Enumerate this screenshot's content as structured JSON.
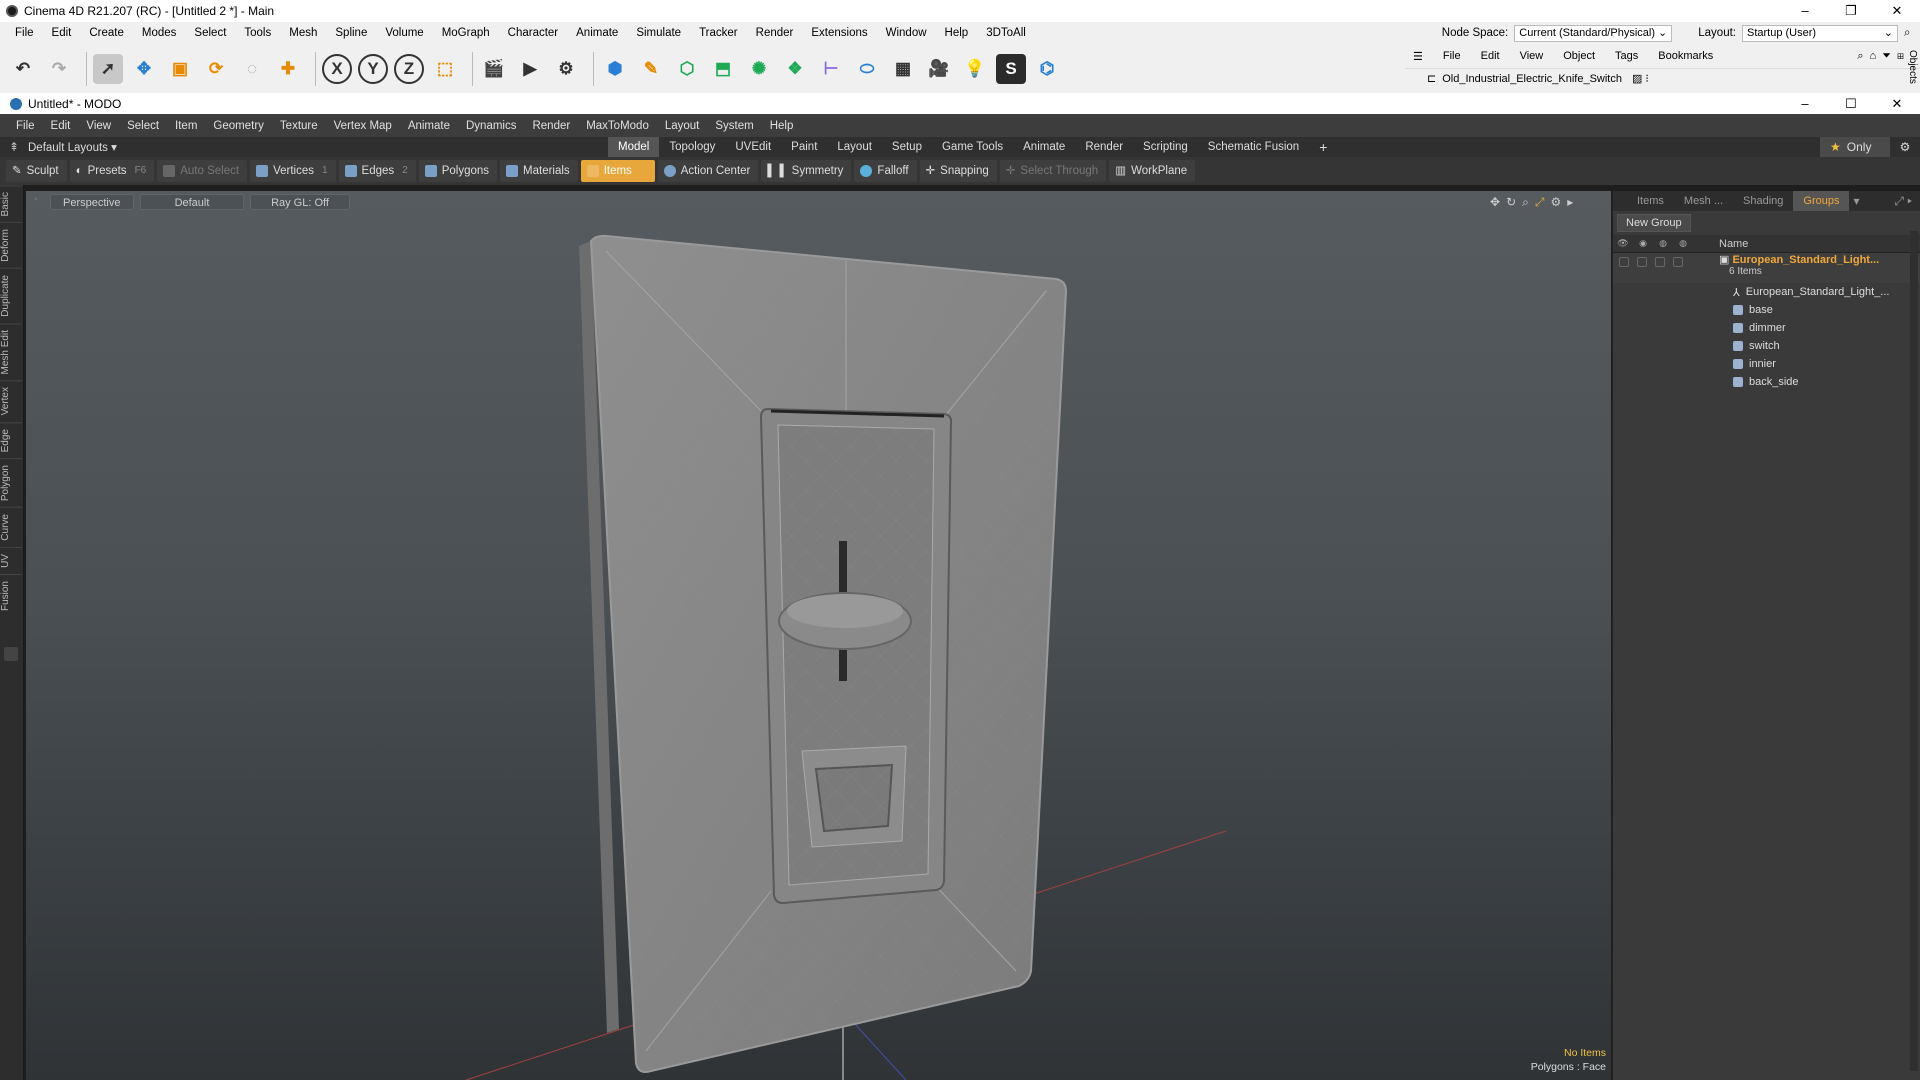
{
  "c4d": {
    "title": "Cinema 4D R21.207 (RC) - [Untitled 2 *] - Main",
    "menu": [
      "File",
      "Edit",
      "Create",
      "Modes",
      "Select",
      "Tools",
      "Mesh",
      "Spline",
      "Volume",
      "MoGraph",
      "Character",
      "Animate",
      "Simulate",
      "Tracker",
      "Render",
      "Extensions",
      "Window",
      "Help",
      "3DToAll"
    ],
    "node_space_label": "Node Space:",
    "node_space_value": "Current (Standard/Physical)",
    "layout_label": "Layout:",
    "layout_value": "Startup (User)",
    "om_menu": [
      "File",
      "Edit",
      "View",
      "Object",
      "Tags",
      "Bookmarks"
    ],
    "om_object": "Old_Industrial_Electric_Knife_Switch",
    "side_label": "Objects",
    "toolbar_axes": [
      "X",
      "Y",
      "Z"
    ]
  },
  "modo": {
    "title": "Untitled* - MODO",
    "menu": [
      "File",
      "Edit",
      "View",
      "Select",
      "Item",
      "Geometry",
      "Texture",
      "Vertex Map",
      "Animate",
      "Dynamics",
      "Render",
      "MaxToModo",
      "Layout",
      "System",
      "Help"
    ],
    "layouts_dropdown": "Default Layouts",
    "layout_tabs": [
      "Model",
      "Topology",
      "UVEdit",
      "Paint",
      "Layout",
      "Setup",
      "Game Tools",
      "Animate",
      "Render",
      "Scripting",
      "Schematic Fusion"
    ],
    "add_tab": "+",
    "only_label": "Only",
    "tools": {
      "sculpt": "Sculpt",
      "presets": "Presets",
      "presets_key": "F6",
      "auto_select": "Auto Select",
      "vertices": "Vertices",
      "vertices_num": "1",
      "edges": "Edges",
      "edges_num": "2",
      "polygons": "Polygons",
      "materials": "Materials",
      "items": "Items",
      "action_center": "Action Center",
      "symmetry": "Symmetry",
      "falloff": "Falloff",
      "snapping": "Snapping",
      "select_through": "Select Through",
      "workplane": "WorkPlane"
    },
    "left_tabs": [
      "Basic",
      "Deform",
      "Duplicate",
      "Mesh Edit",
      "Vertex",
      "Edge",
      "Polygon",
      "Curve",
      "UV",
      "Fusion"
    ],
    "viewport": {
      "view": "Perspective",
      "shading": "Default",
      "raygl": "Ray GL: Off",
      "status_items": "No Items",
      "status_polys": "Polygons : Face"
    },
    "panel": {
      "tabs": [
        "Items",
        "Mesh ...",
        "Shading",
        "Groups"
      ],
      "new_group": "New Group",
      "name_header": "Name",
      "group_name": "European_Standard_Light...",
      "group_count": "6 Items",
      "children": [
        "European_Standard_Light_...",
        "base",
        "dimmer",
        "switch",
        "innier",
        "back_side"
      ]
    }
  },
  "colors": {
    "accent": "#e8a73a",
    "group_title": "#f0a73a",
    "viewport_top": "#565b5f",
    "viewport_bottom": "#2f3336"
  }
}
